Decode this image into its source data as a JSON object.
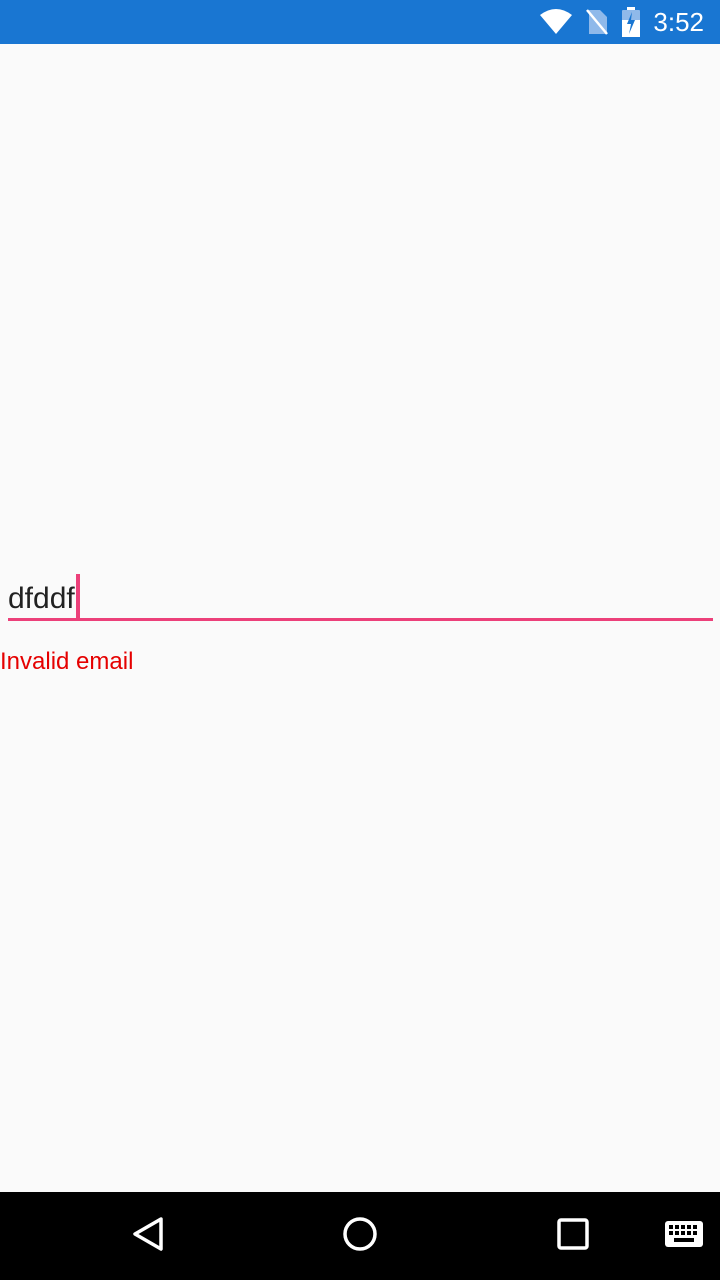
{
  "status_bar": {
    "time": "3:52",
    "background_color": "#1976d2",
    "icons": [
      "wifi-icon",
      "no-sim-icon",
      "battery-charging-icon"
    ]
  },
  "email_field": {
    "value": "dfddf",
    "accent_color": "#ec407a",
    "error_text": "Invalid email",
    "error_color": "#e50000"
  },
  "navigation_bar": {
    "buttons": [
      "back-icon",
      "home-icon",
      "recents-icon",
      "keyboard-icon"
    ]
  }
}
